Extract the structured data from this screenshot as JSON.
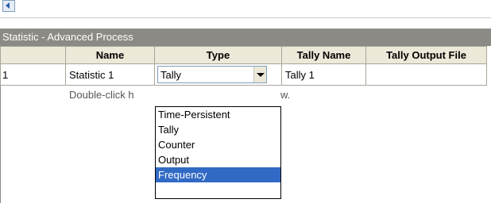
{
  "window": {
    "title": "Statistic - Advanced Process"
  },
  "grid": {
    "columns": [
      "",
      "Name",
      "Type",
      "Tally Name",
      "Tally Output File"
    ],
    "rows": [
      {
        "index": "1",
        "name": "Statistic 1",
        "type": "Tally",
        "tally_name": "Tally 1",
        "tally_output_file": ""
      }
    ],
    "hint_visible_left": "Double-click h",
    "hint_visible_right": "w."
  },
  "type_dropdown": {
    "selected_value": "Tally",
    "options": [
      "Time-Persistent",
      "Tally",
      "Counter",
      "Output",
      "Frequency"
    ],
    "highlighted": "Frequency"
  },
  "colors": {
    "titlebar": "#8c8a84",
    "header_bg": "#ece9d8",
    "highlight": "#316ac5"
  }
}
